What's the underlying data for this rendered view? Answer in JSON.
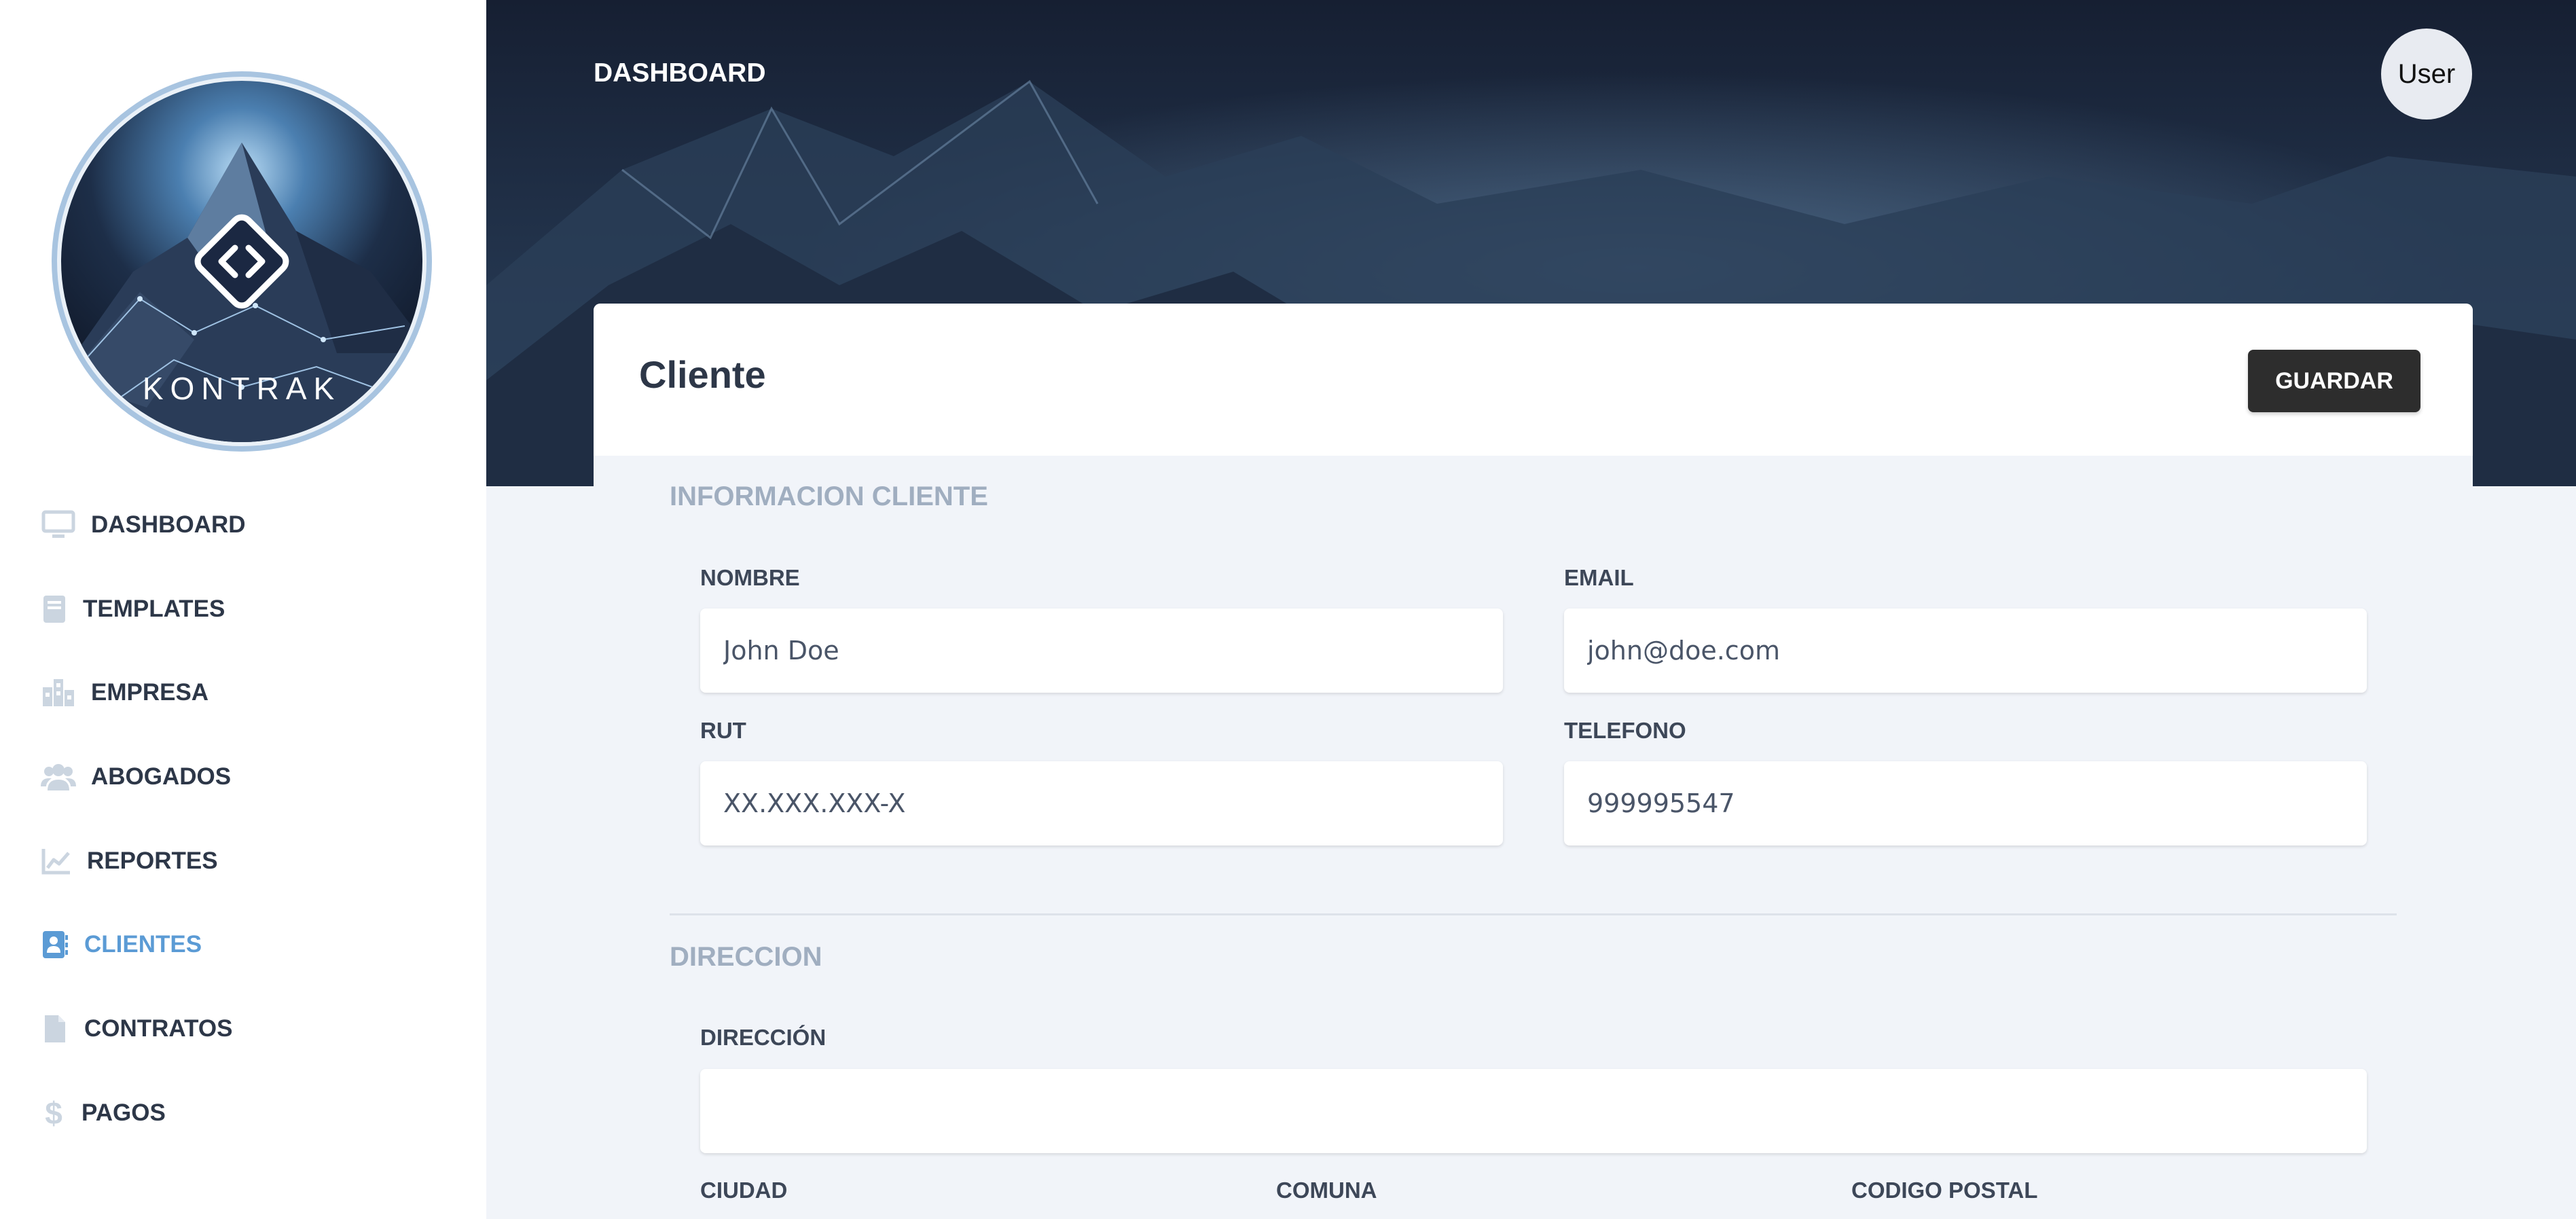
{
  "logo": {
    "text": "KONTRAK"
  },
  "sidebar": {
    "items": [
      {
        "label": "DASHBOARD",
        "icon": "monitor-icon"
      },
      {
        "label": "TEMPLATES",
        "icon": "book-icon"
      },
      {
        "label": "EMPRESA",
        "icon": "building-icon"
      },
      {
        "label": "ABOGADOS",
        "icon": "users-icon"
      },
      {
        "label": "REPORTES",
        "icon": "chart-line-icon"
      },
      {
        "label": "CLIENTES",
        "icon": "address-book-icon",
        "active": true
      },
      {
        "label": "CONTRATOS",
        "icon": "file-icon"
      },
      {
        "label": "PAGOS",
        "icon": "dollar-icon"
      }
    ]
  },
  "header": {
    "title": "DASHBOARD",
    "user_label": "User"
  },
  "card": {
    "title": "Cliente",
    "save_label": "GUARDAR",
    "sections": {
      "info": {
        "title": "INFORMACION CLIENTE",
        "nombre": {
          "label": "NOMBRE",
          "value": "John Doe"
        },
        "email": {
          "label": "EMAIL",
          "value": "john@doe.com"
        },
        "rut": {
          "label": "RUT",
          "placeholder": "XX.XXX.XXX-X"
        },
        "telefono": {
          "label": "TELEFONO",
          "value": "999995547"
        }
      },
      "direccion": {
        "title": "DIRECCION",
        "direccion": {
          "label": "DIRECCIÓN",
          "value": ""
        },
        "ciudad": {
          "label": "CIUDAD"
        },
        "comuna": {
          "label": "COMUNA"
        },
        "codigo_postal": {
          "label": "CODIGO POSTAL"
        }
      }
    }
  },
  "colors": {
    "accent": "#5b9bd5",
    "text": "#2d3748",
    "muted": "#a0aec0",
    "button": "#2d2d2d"
  }
}
